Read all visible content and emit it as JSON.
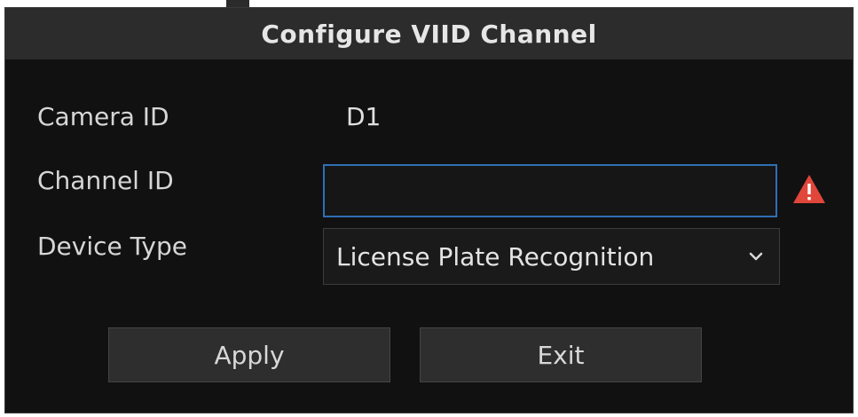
{
  "dialog": {
    "title": "Configure VIID Channel"
  },
  "form": {
    "camera_id_label": "Camera ID",
    "camera_id_value": "D1",
    "channel_id_label": "Channel ID",
    "channel_id_value": "",
    "channel_id_status_icon": "warning-icon",
    "device_type_label": "Device Type",
    "device_type_value": "License Plate Recognition"
  },
  "buttons": {
    "apply_label": "Apply",
    "exit_label": "Exit"
  },
  "colors": {
    "dialog_bg": "#111111",
    "titlebar_bg": "#2c2c2c",
    "input_focus_border": "#2f6fb3",
    "warning": "#e0463a"
  }
}
